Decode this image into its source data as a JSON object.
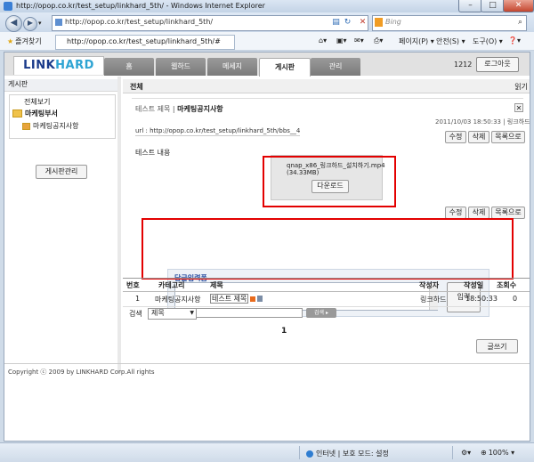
{
  "window": {
    "title": "http://opop.co.kr/test_setup/linkhard_5th/ - Windows Internet Explorer"
  },
  "browser": {
    "address": "http://opop.co.kr/test_setup/linkhard_5th/",
    "search_placeholder": "Bing",
    "favorites_label": "즐겨찾기",
    "tab_title": "http://opop.co.kr/test_setup/linkhard_5th/#",
    "cmd_page": "페이지(P) ▾",
    "cmd_safety": "안전(S) ▾",
    "cmd_tools": "도구(O) ▾",
    "cmd_help": "❓▾"
  },
  "app": {
    "logo_a": "LINK",
    "logo_b": "HARD",
    "nav": [
      "홈",
      "웹하드",
      "메세지",
      "게시판",
      "관리"
    ],
    "active_nav": "게시판",
    "user_count": "1212",
    "logout_label": "로그아웃"
  },
  "sidebar": {
    "title": "게시판",
    "view_all": "전체보기",
    "folder": "마케팅부서",
    "subfolder": "마케팅공지사항",
    "manage_button": "게시판관리"
  },
  "main": {
    "header_left": "전체",
    "header_right": "읽기",
    "post": {
      "title_prefix": "테스트 제목",
      "title_board": "마케팅공지사항",
      "datetime_author": "2011/10/03 18:50:33 | 링크하드",
      "url_text": "url : http://opop.co.kr/test_setup/linkhard_5th/bbs__4",
      "edit_label": "수정",
      "delete_label": "삭제",
      "list_label": "목록으로",
      "content": "테스트 내용",
      "attachment_name": "qnap_x86_링크하드_설치하기.mp4",
      "attachment_size": "(34.33MB)",
      "download_label": "다운로드"
    },
    "reply": {
      "label": "답글입력폼",
      "submit_label": "입력"
    }
  },
  "table": {
    "headers": [
      "번호",
      "카테고리",
      "제목",
      "작성자",
      "작성일",
      "조회수"
    ],
    "rows": [
      {
        "no": "1",
        "category": "마케팅공지사항",
        "title": "테스트 제목",
        "author": "링크하드",
        "date": "18:50:33",
        "views": "0"
      }
    ]
  },
  "search": {
    "label": "검색",
    "field": "제목",
    "button": "검색 ▸"
  },
  "pagination": {
    "current": "1"
  },
  "write_button": "글쓰기",
  "copyright": "Copyright ⓒ 2009 by LINKHARD Corp.All rights",
  "statusbar": {
    "zone": "인터넷 | 보호 모드: 설정",
    "zoom": "100%"
  },
  "colors": {
    "highlight": "#e30000",
    "logo_dark": "#1a3a8a",
    "logo_light": "#2ea4d3"
  }
}
